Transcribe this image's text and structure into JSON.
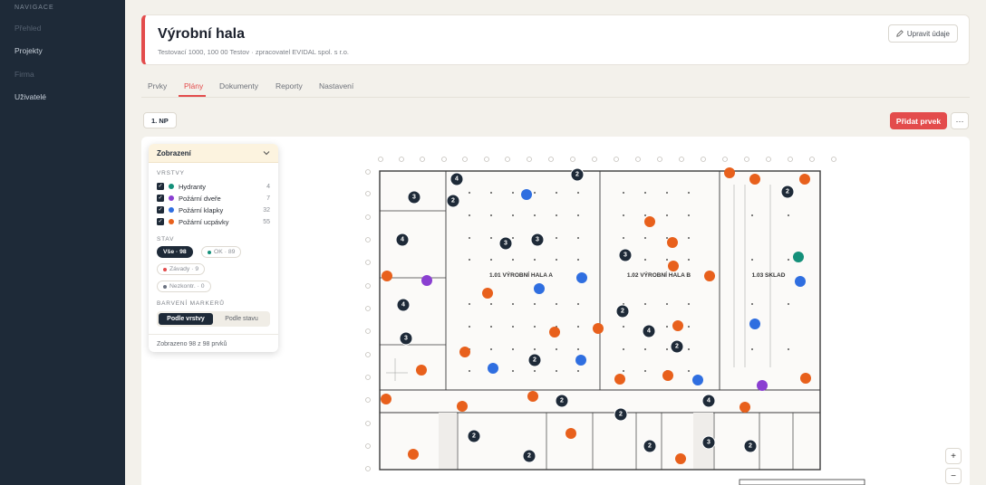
{
  "nav": {
    "heading": "NAVIGACE",
    "items": [
      {
        "label": "Přehled",
        "state": "dim"
      },
      {
        "label": "Projekty",
        "state": "normal"
      },
      {
        "label": "Firma",
        "state": "dim"
      },
      {
        "label": "Uživatelé",
        "state": "normal"
      }
    ]
  },
  "header": {
    "title": "Výrobní hala",
    "subtitle": "Testovací 1000, 100 00 Testov · zpracovatel EVIDAL spol. s r.o.",
    "edit_label": "Upravit údaje",
    "edit_icon": "pencil-icon"
  },
  "tabs": [
    {
      "label": "Prvky",
      "active": false
    },
    {
      "label": "Plány",
      "active": true
    },
    {
      "label": "Dokumenty",
      "active": false
    },
    {
      "label": "Reporty",
      "active": false
    },
    {
      "label": "Nastavení",
      "active": false
    }
  ],
  "toolbar": {
    "floor_label": "1. NP",
    "add_label": "Přidat prvek",
    "more_label": "···"
  },
  "panel": {
    "title": "Zobrazení",
    "layers_heading": "VRSTVY",
    "layers": [
      {
        "label": "Hydranty",
        "count": "4",
        "color": "#14907a",
        "checked": true
      },
      {
        "label": "Požární dveře",
        "count": "7",
        "color": "#8a3fd1",
        "checked": true
      },
      {
        "label": "Požární klapky",
        "count": "32",
        "color": "#2f6ee0",
        "checked": true
      },
      {
        "label": "Požární ucpávky",
        "count": "55",
        "color": "#e8601c",
        "checked": true
      }
    ],
    "state_heading": "STAV",
    "states": [
      {
        "label": "Vše · 98",
        "active": true
      },
      {
        "label": "OK · 89",
        "color": "#14907a"
      },
      {
        "label": "Závady · 9",
        "color": "#e34c4c"
      },
      {
        "label": "Nezkontr. · 0",
        "color": "#6b7280"
      }
    ],
    "coloring_heading": "BARVENÍ MARKERŮ",
    "coloring": [
      {
        "label": "Podle vrstvy",
        "active": true
      },
      {
        "label": "Podle stavu",
        "active": false
      }
    ],
    "footer": "Zobrazeno 98 z 98 prvků"
  },
  "plan": {
    "rooms": [
      {
        "label": "1.01 VÝROBNÍ HALA A"
      },
      {
        "label": "1.02 VÝROBNÍ HALA B"
      },
      {
        "label": "1.03 SKLAD"
      }
    ],
    "clusters": [
      "4",
      "2",
      "2",
      "3",
      "2",
      "4",
      "3",
      "3",
      "3",
      "4",
      "2",
      "4",
      "3",
      "2",
      "2",
      "4",
      "2",
      "2",
      "2",
      "2",
      "3",
      "2"
    ]
  },
  "zoom": {
    "in_label": "+",
    "out_label": "−"
  }
}
